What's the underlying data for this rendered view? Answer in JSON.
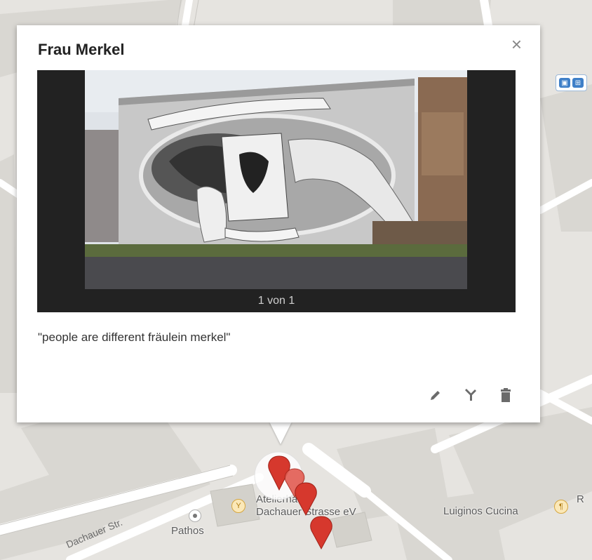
{
  "info_window": {
    "title": "Frau Merkel",
    "close_label": "×",
    "photo_counter": "1 von 1",
    "description": "\"people are different fräulein merkel\"",
    "actions": {
      "edit": "edit",
      "style": "style",
      "delete": "delete"
    }
  },
  "map": {
    "labels": {
      "atelierhaus": "Atelierhaus",
      "atelierhaus_line2": "Dachauer Strasse eV",
      "luiginos": "Luiginos Cucina",
      "pathos": "Pathos",
      "street": "Dachauer Str.",
      "r_partial": "R"
    },
    "transit_icons": [
      "bus-icon",
      "tram-icon"
    ]
  },
  "colors": {
    "accent_marker": "#d6382d",
    "map_background": "#e8e6e2",
    "road": "#ffffff",
    "block": "#dcdad5"
  }
}
